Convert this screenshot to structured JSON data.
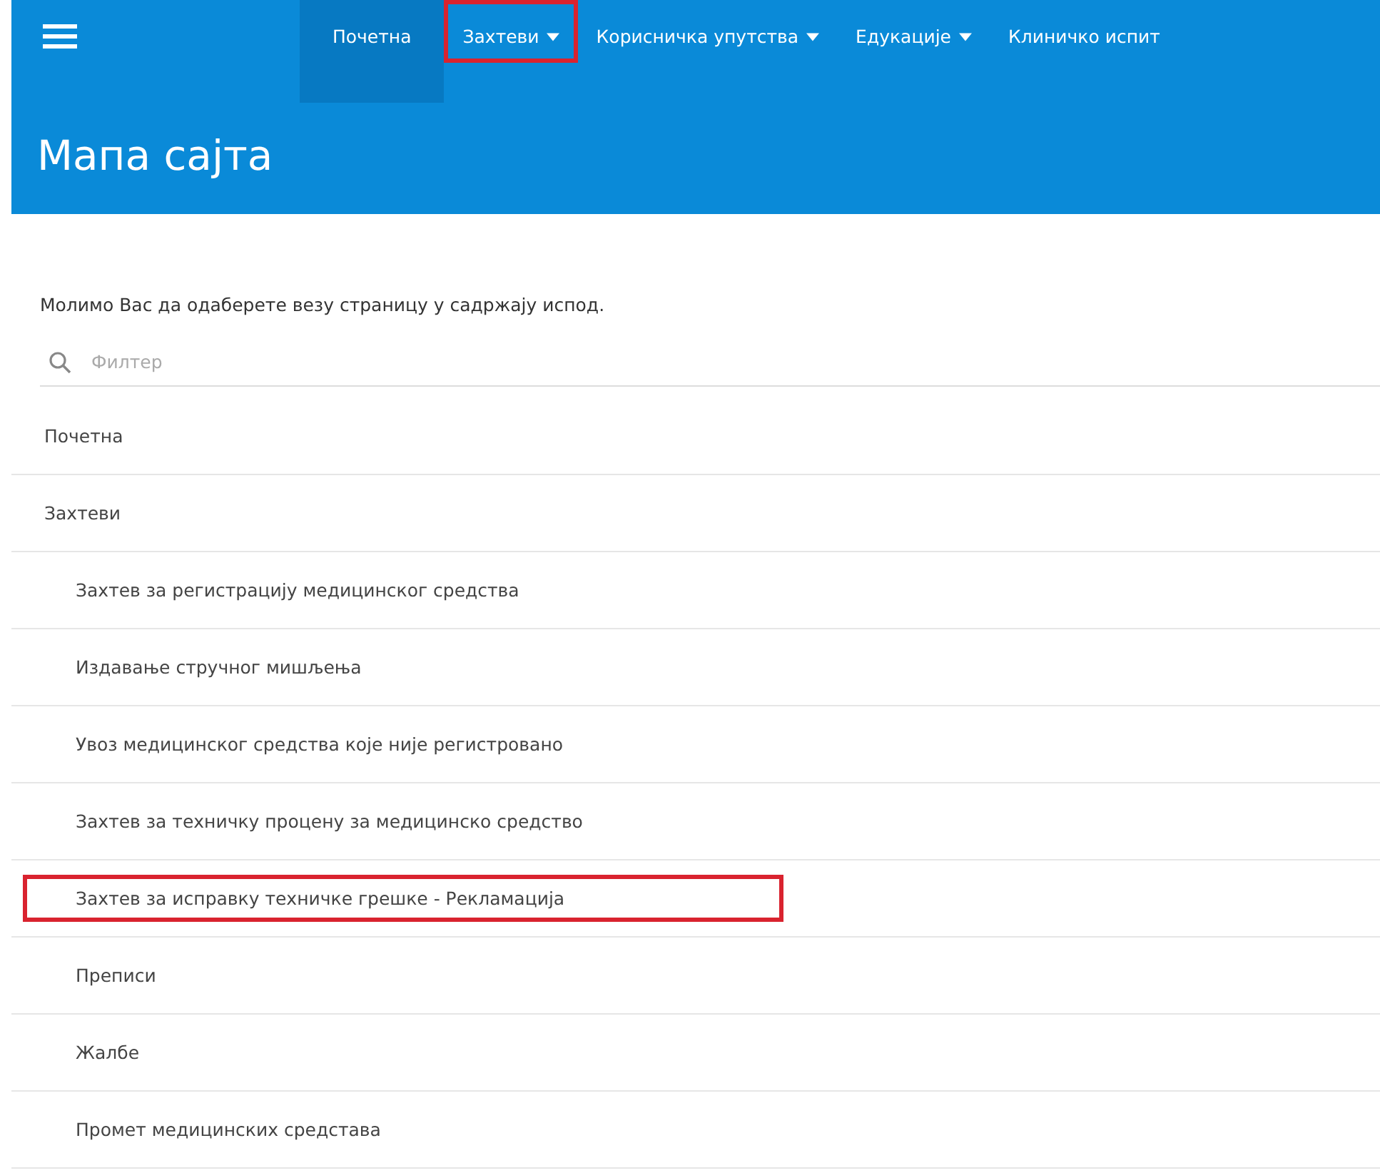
{
  "nav": {
    "items": [
      {
        "label": "Почетна",
        "selected": true,
        "dropdown": false,
        "highlighted": false
      },
      {
        "label": "Захтеви",
        "selected": false,
        "dropdown": true,
        "highlighted": true
      },
      {
        "label": "Корисничка упутства",
        "selected": false,
        "dropdown": true,
        "highlighted": false
      },
      {
        "label": "Едукације",
        "selected": false,
        "dropdown": true,
        "highlighted": false
      },
      {
        "label": "Клиничко испит",
        "selected": false,
        "dropdown": false,
        "highlighted": false
      }
    ]
  },
  "page_title": "Мапа сајта",
  "intro": "Молимо Вас да одаберете везу страницу у садржају испод.",
  "filter": {
    "placeholder": "Филтер"
  },
  "sitemap": [
    {
      "label": "Почетна",
      "highlighted": false
    },
    {
      "label": "Захтеви",
      "highlighted": false,
      "children": [
        {
          "label": "Захтев за регистрацију медицинског средства",
          "highlighted": false
        },
        {
          "label": "Издавање стручног мишљења",
          "highlighted": false
        },
        {
          "label": "Увоз медицинског средства које није регистровано",
          "highlighted": false
        },
        {
          "label": "Захтев за техничку процену за медицинско средство",
          "highlighted": false
        },
        {
          "label": "Захтев за исправку техничке грешке - Рекламација",
          "highlighted": true
        },
        {
          "label": "Преписи",
          "highlighted": false
        },
        {
          "label": "Жалбе",
          "highlighted": false
        },
        {
          "label": "Промет медицинских средстава",
          "highlighted": false
        }
      ]
    }
  ]
}
